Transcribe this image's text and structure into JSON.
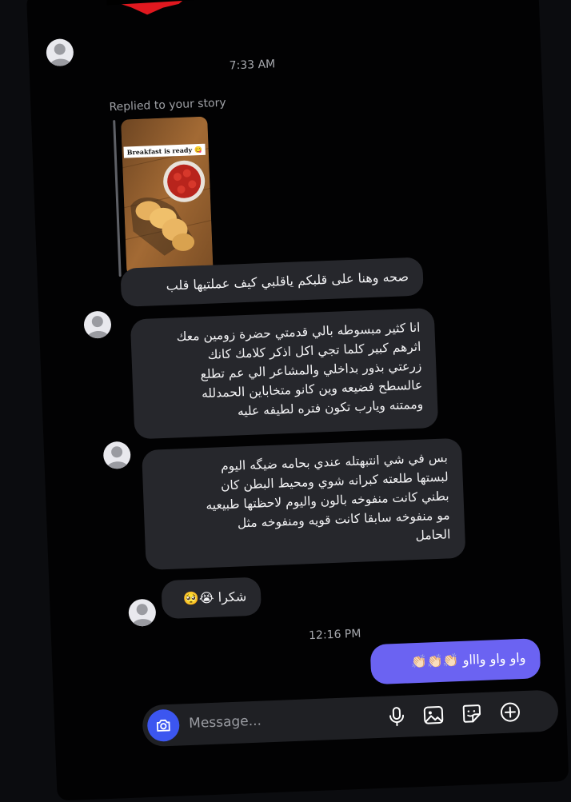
{
  "chat": {
    "time_1": "7:33 AM",
    "replied_label": "Replied to your story",
    "story_caption": "Breakfast is ready 😋",
    "messages": [
      "صحه وهنا على قلبكم ياقلبي كيف عملتيها قلب",
      "انا كثير مبسوطه بالي قدمتي حضرة زومين معك\nاثرهم كبير كلما تجي اكل اذكر كلامك كانك\nزرعتي بذور بداخلي والمشاعر الي عم تطلع\nعالسطح فضيعه وين كانو متخاباين الحمدلله\nوممتنه ويارب تكون فتره لطيفه عليه",
      "بس في شي انتبهتله عندي بحامه ضيگه اليوم\nلبستها طلعته كبرانه شوي ومحيط البطن كان\nبطني كانت منفوخه بالون واليوم لاحظتها طبيعيه\nمو منفوخه سابقا كانت قويه ومنفوخه مثل\nالحامل",
      "شكرا 😭🥺"
    ],
    "time_2": "12:16 PM",
    "sent_message": "واو واو واااو 👏🏻👏🏻👏🏻"
  },
  "composer": {
    "placeholder": "Message..."
  },
  "icons": {
    "camera": "camera-icon",
    "mic": "microphone-icon",
    "gallery": "gallery-icon",
    "sticker": "sticker-icon",
    "add": "plus-circle-icon"
  },
  "colors": {
    "background": "#020203",
    "incoming_bubble": "#26272c",
    "outgoing_bubble": "#6b63f2",
    "camera_button": "#3c56f0"
  }
}
